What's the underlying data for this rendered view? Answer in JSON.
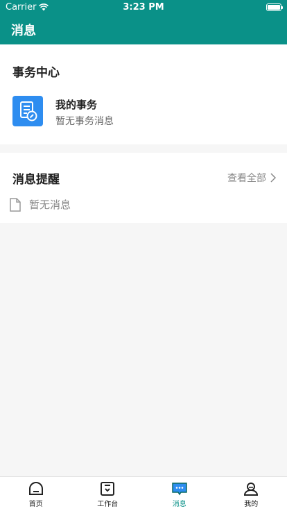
{
  "status_bar": {
    "carrier": "Carrier",
    "time": "3:23 PM"
  },
  "header": {
    "title": "消息"
  },
  "affairs_center": {
    "title": "事务中心",
    "item": {
      "name": "我的事务",
      "desc": "暂无事务消息",
      "icon": "document-icon"
    }
  },
  "reminders": {
    "title": "消息提醒",
    "view_all": "查看全部",
    "empty_text": "暂无消息"
  },
  "tabbar": {
    "items": [
      {
        "label": "首页",
        "icon": "home-icon"
      },
      {
        "label": "工作台",
        "icon": "workbench-icon"
      },
      {
        "label": "消息",
        "icon": "message-icon",
        "active": true
      },
      {
        "label": "我的",
        "icon": "profile-icon"
      }
    ]
  },
  "colors": {
    "brand": "#0a9188",
    "icon_blue": "#2e8df0"
  }
}
